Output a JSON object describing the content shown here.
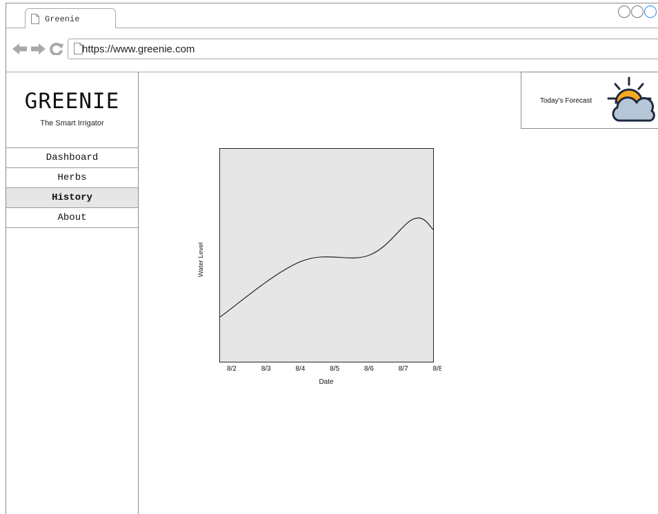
{
  "browser": {
    "tab_title": "Greenie",
    "url": "https://www.greenie.com"
  },
  "sidebar": {
    "brand": "GREENIE",
    "tagline": "The Smart Irrigator",
    "items": [
      {
        "label": "Dashboard",
        "active": false
      },
      {
        "label": "Herbs",
        "active": false
      },
      {
        "label": "History",
        "active": true
      },
      {
        "label": "About",
        "active": false
      }
    ]
  },
  "forecast": {
    "label": "Today's Forecast",
    "icon": "partly-cloudy-icon",
    "colors": {
      "sun": "#f7a823",
      "cloud": "#b7c6d6",
      "outline": "#1e2a40"
    }
  },
  "chart_data": {
    "type": "line",
    "xlabel": "Date",
    "ylabel": "Water Level",
    "categories": [
      "8/2",
      "8/3",
      "8/4",
      "8/5",
      "8/6",
      "8/7",
      "8/8"
    ],
    "series": [
      {
        "x": [
          1.65,
          4.0,
          6.0,
          7.3,
          7.88
        ],
        "values": [
          0.21,
          0.47,
          0.5,
          0.67,
          0.62
        ]
      }
    ],
    "xlim": [
      1.65,
      7.88
    ],
    "ylim": [
      0,
      1
    ],
    "grid": false,
    "plot_background": "#e6e6e6",
    "line_color": "#222222"
  }
}
